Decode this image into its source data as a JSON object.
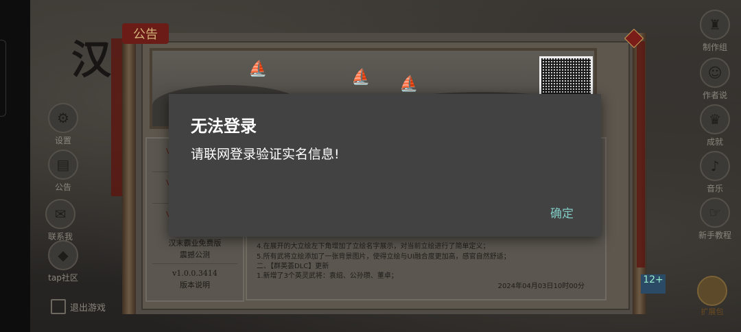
{
  "game": {
    "title_char": "汉",
    "announcement_tab": "公告",
    "left_menu": [
      {
        "label": "设置",
        "icon": "gear-icon"
      },
      {
        "label": "公告",
        "icon": "scroll-icon"
      },
      {
        "label": "联系我",
        "icon": "chat-icon"
      },
      {
        "label": "tap社区",
        "icon": "community-icon"
      }
    ],
    "exit_label": "退出游戏",
    "right_menu": [
      {
        "label": "制作组",
        "icon": "team-icon"
      },
      {
        "label": "作者说",
        "icon": "author-icon"
      },
      {
        "label": "成就",
        "icon": "trophy-icon"
      },
      {
        "label": "音乐",
        "icon": "music-icon"
      },
      {
        "label": "新手教程",
        "icon": "tutorial-icon"
      }
    ],
    "gift_label": "扩展包",
    "age_badge": "12+",
    "version_list": {
      "stubs": [
        "V",
        "V",
        "V"
      ],
      "item1_line1": "汉末霸业免费版",
      "item1_line2": "震撼公测",
      "item2_line1": "v1.0.0.3414",
      "item2_line2": "版本说明"
    },
    "content_lines": [
      "4.在展开的大立绘左下角增加了立绘名字展示，对当前立绘进行了简单定义；",
      "5.所有武将立绘添加了一张背景图片，使得立绘与UI融合度更加高，感官自然舒适；",
      "二、【群英荟DLC】更新",
      "1.新增了3个英灵武将：袁绍、公孙瓒、董卓；"
    ],
    "content_date": "2024年04月03日10时00分"
  },
  "dialog": {
    "title": "无法登录",
    "message": "请联网登录验证实名信息!",
    "confirm_label": "确定"
  },
  "colors": {
    "dialog_bg": "#424242",
    "dialog_text": "#ffffff",
    "accent": "#80cbc4"
  }
}
